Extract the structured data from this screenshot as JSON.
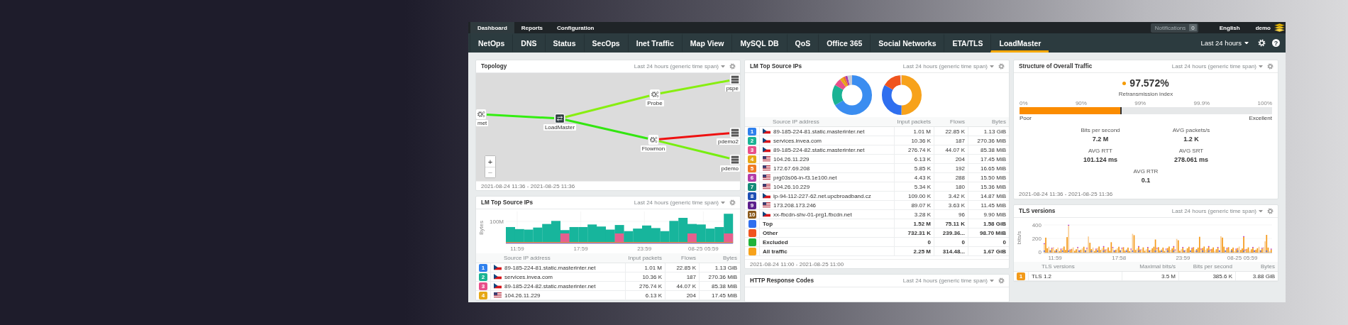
{
  "top_bar": {
    "tabs": [
      {
        "label": "Dashboard",
        "selected": true
      },
      {
        "label": "Reports",
        "selected": false
      },
      {
        "label": "Configuration",
        "selected": false
      }
    ],
    "notifications": {
      "label": "Notifications",
      "count": "0"
    },
    "language": "English",
    "user": "demo"
  },
  "nav": {
    "items": [
      {
        "label": "NetOps",
        "selected": false
      },
      {
        "label": "DNS",
        "selected": false
      },
      {
        "label": "Status",
        "selected": false
      },
      {
        "label": "SecOps",
        "selected": false
      },
      {
        "label": "Inet Traffic",
        "selected": false
      },
      {
        "label": "Map View",
        "selected": false
      },
      {
        "label": "MySQL DB",
        "selected": false
      },
      {
        "label": "QoS",
        "selected": false
      },
      {
        "label": "Office 365",
        "selected": false
      },
      {
        "label": "Social Networks",
        "selected": false
      },
      {
        "label": "ETA/TLS",
        "selected": false
      },
      {
        "label": "LoadMaster",
        "selected": true
      }
    ],
    "time_range": "Last 24 hours",
    "help": "?"
  },
  "topology": {
    "title": "Topology",
    "time_span": "Last 24 hours (generic time span)",
    "nodes": [
      {
        "label": "met",
        "kind": "probe"
      },
      {
        "label": "LoadMaster",
        "kind": "loadmaster"
      },
      {
        "label": "Probe",
        "kind": "probe"
      },
      {
        "label": "Flowmon",
        "kind": "probe"
      },
      {
        "label": "pspe",
        "kind": "server"
      },
      {
        "label": "pdemo2",
        "kind": "server"
      },
      {
        "label": "pdemo",
        "kind": "server"
      }
    ],
    "links": [
      {
        "color": "#33ee11"
      },
      {
        "color": "#88ee11"
      },
      {
        "color": "#88ee11"
      },
      {
        "color": "#33e611"
      },
      {
        "color": "#ee1111"
      },
      {
        "color": "#77ee11"
      }
    ],
    "zoom_in": "+",
    "zoom_out": "−",
    "footer": "2021-08-24 11:36 - 2021-08-25 11:36"
  },
  "top_source_chart": {
    "title": "LM Top Source IPs",
    "time_span": "Last 24 hours (generic time span)",
    "ylabel": "Bytes",
    "yticks": [
      "100M"
    ],
    "xticks": [
      "11:59",
      "17:59",
      "23:59",
      "08-25 05:59"
    ],
    "columns": [
      "Source IP address",
      "Input packets",
      "Flows",
      "Bytes"
    ],
    "rows": [
      {
        "rank": "1",
        "color": "#2f80ed",
        "host": "89-185-224-81.static.masterinter.net",
        "packets": "1.01 M",
        "flows": "22.85 K",
        "bytes": "1.13 GiB"
      },
      {
        "rank": "2",
        "color": "#1ab394",
        "host": "services.invea.com",
        "packets": "10.36 K",
        "flows": "187",
        "bytes": "270.36 MiB"
      },
      {
        "rank": "3",
        "color": "#e8508a",
        "host": "89-185-224-82.static.masterinter.net",
        "packets": "276.74 K",
        "flows": "44.07 K",
        "bytes": "85.38 MiB"
      },
      {
        "rank": "4",
        "color": "#e6a817",
        "host": "104.26.11.229",
        "packets": "6.13 K",
        "flows": "204",
        "bytes": "17.45 MiB"
      }
    ]
  },
  "top_source_ips": {
    "title": "LM Top Source IPs",
    "time_span": "Last 24 hours (generic time span)",
    "columns": [
      "Source IP address",
      "Input packets",
      "Flows",
      "Bytes"
    ],
    "rows": [
      {
        "rank": "1",
        "color": "#2f80ed",
        "host": "89-185-224-81.static.masterinter.net",
        "packets": "1.01 M",
        "flows": "22.85 K",
        "bytes": "1.13 GiB"
      },
      {
        "rank": "2",
        "color": "#1ab394",
        "host": "services.invea.com",
        "packets": "10.36 K",
        "flows": "187",
        "bytes": "270.36 MiB"
      },
      {
        "rank": "3",
        "color": "#e8508a",
        "host": "89-185-224-82.static.masterinter.net",
        "packets": "276.74 K",
        "flows": "44.07 K",
        "bytes": "85.38 MiB"
      },
      {
        "rank": "4",
        "color": "#e6a817",
        "host": "104.26.11.229",
        "packets": "6.13 K",
        "flows": "204",
        "bytes": "17.45 MiB"
      },
      {
        "rank": "5",
        "color": "#ef7a22",
        "host": "172.67.69.208",
        "packets": "5.85 K",
        "flows": "192",
        "bytes": "16.65 MiB"
      },
      {
        "rank": "6",
        "color": "#b23ca8",
        "host": "prg03s06-in-f3.1e100.net",
        "packets": "4.43 K",
        "flows": "288",
        "bytes": "15.50 MiB"
      },
      {
        "rank": "7",
        "color": "#138a78",
        "host": "104.26.10.229",
        "packets": "5.34 K",
        "flows": "180",
        "bytes": "15.36 MiB"
      },
      {
        "rank": "8",
        "color": "#1e4fb4",
        "host": "ip-94-112-227-62.net.upcbroadband.cz",
        "packets": "109.00 K",
        "flows": "3.42 K",
        "bytes": "14.87 MiB"
      },
      {
        "rank": "9",
        "color": "#5c1f8c",
        "host": "173.208.173.246",
        "packets": "89.07 K",
        "flows": "3.63 K",
        "bytes": "11.45 MiB"
      },
      {
        "rank": "10",
        "color": "#8a5a1c",
        "host": "xx-fbcdn-shv-01-prg1.fbcdn.net",
        "packets": "3.28 K",
        "flows": "96",
        "bytes": "9.90 MiB"
      }
    ],
    "totals": [
      {
        "label": "Top",
        "color": "#2f6fef",
        "packets": "1.52 M",
        "flows": "75.11 K",
        "bytes": "1.58 GiB"
      },
      {
        "label": "Other",
        "color": "#f0541e",
        "packets": "732.31 K",
        "flows": "239.36...",
        "bytes": "98.70 MiB"
      },
      {
        "label": "Excluded",
        "color": "#22b33a",
        "packets": "0",
        "flows": "0",
        "bytes": "0"
      },
      {
        "label": "All traffic",
        "color": "#f7a21b",
        "packets": "2.25 M",
        "flows": "314.48...",
        "bytes": "1.67 GiB"
      }
    ],
    "footer": "2021-08-24 11:00 - 2021-08-25 11:00"
  },
  "http_response_codes": {
    "title": "HTTP Response Codes",
    "time_span": "Last 24 hours (generic time span)"
  },
  "overall_traffic": {
    "title": "Structure of Overall Traffic",
    "time_span": "Last 24 hours (generic time span)",
    "index_value": "97.572%",
    "index_label": "Retransmission index",
    "scale": [
      "0%",
      "90%",
      "99%",
      "99.9%",
      "100%"
    ],
    "level": 0.405,
    "scale_low": "Poor",
    "scale_high": "Excellent",
    "metrics": [
      {
        "label": "Bits per second",
        "value": "7.2 M"
      },
      {
        "label": "AVG packets/s",
        "value": "1.2 K"
      },
      {
        "label": "AVG RTT",
        "value": "101.124 ms"
      },
      {
        "label": "AVG SRT",
        "value": "278.061 ms"
      },
      {
        "label": "AVG RTR",
        "value": "0.1"
      }
    ],
    "footer": "2021-08-24 11:36 - 2021-08-25 11:36"
  },
  "tls_versions": {
    "title": "TLS versions",
    "time_span": "Last 24 hours (generic time span)",
    "ylabel": "bits/s",
    "yticks": [
      "400",
      "200",
      "0"
    ],
    "xticks": [
      "11:59",
      "17:58",
      "23:59",
      "08-25 05:59"
    ],
    "columns": [
      "TLS versions",
      "Maximal bits/s",
      "Bits per second",
      "Bytes"
    ],
    "rows": [
      {
        "rank": "1",
        "color": "#f29a1a",
        "name": "TLS 1.2",
        "max": "3.5 M",
        "bps": "385.6 K",
        "bytes": "3.88 GiB"
      }
    ]
  }
}
